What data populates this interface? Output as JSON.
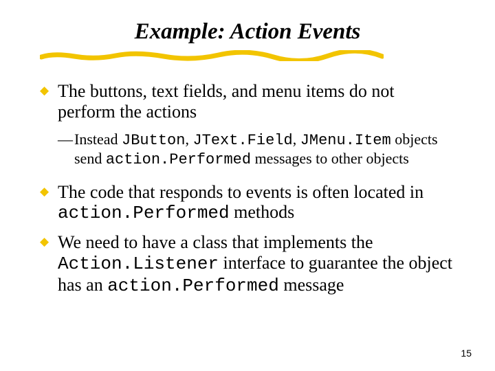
{
  "title": "Example: Action Events",
  "bullets": {
    "b1": "The buttons, text fields, and menu items do not perform the actions",
    "b1sub": {
      "pre": "Instead ",
      "c1": "JButton",
      "s1": ", ",
      "c2": "JText.Field",
      "s2": ", ",
      "c3": "JMenu.Item",
      "mid": " objects send ",
      "c4": "action.Performed",
      "post": " messages to other objects"
    },
    "b2": {
      "pre": "The code that responds to events is often located in ",
      "c1": "action.Performed",
      "post": " methods"
    },
    "b3": {
      "pre": "We need to have a class that implements the ",
      "c1": "Action.Listener",
      "mid": " interface to guarantee the object has an ",
      "c2": "action.Performed",
      "post": " message"
    }
  },
  "pageNumber": "15"
}
